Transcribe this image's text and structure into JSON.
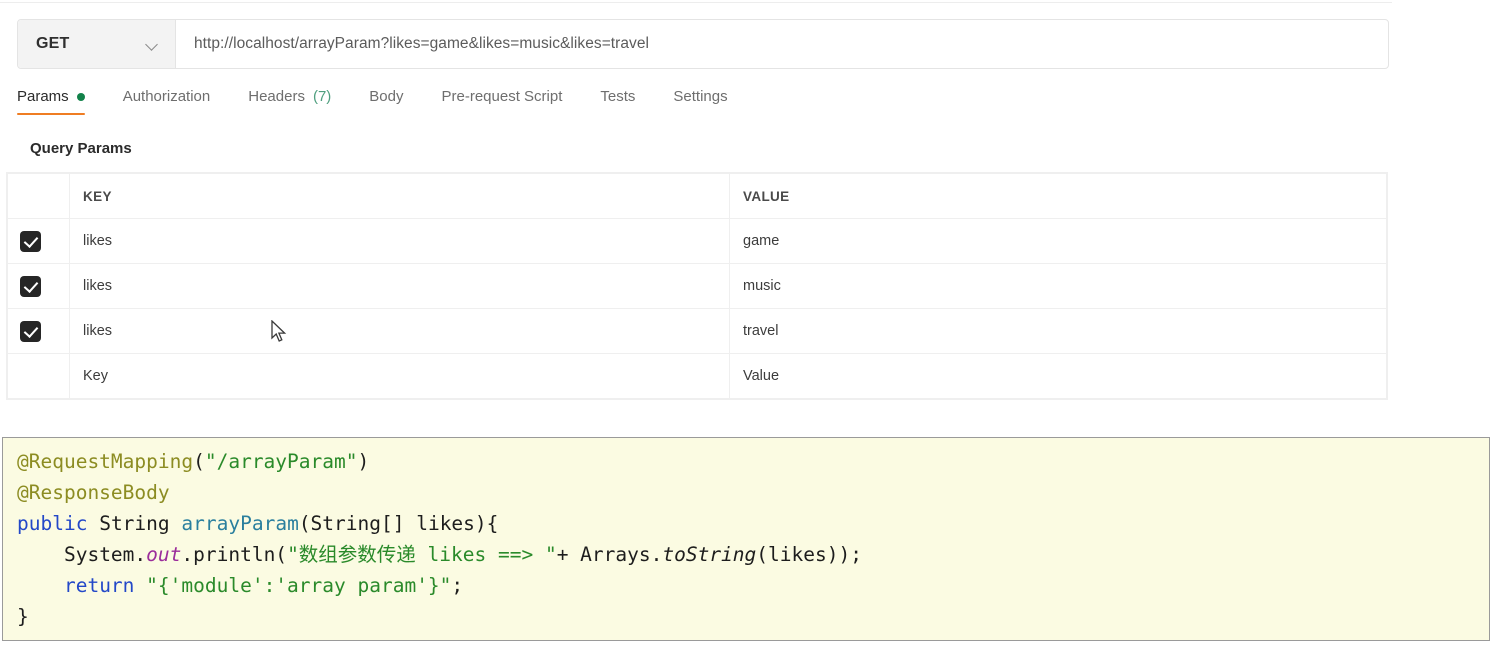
{
  "request": {
    "method": "GET",
    "url": "http://localhost/arrayParam?likes=game&likes=music&likes=travel"
  },
  "tabs": [
    {
      "label": "Params",
      "badge_dot": true,
      "count": "",
      "active": true
    },
    {
      "label": "Authorization",
      "badge_dot": false,
      "count": "",
      "active": false
    },
    {
      "label": "Headers",
      "badge_dot": false,
      "count": "(7)",
      "active": false
    },
    {
      "label": "Body",
      "badge_dot": false,
      "count": "",
      "active": false
    },
    {
      "label": "Pre-request Script",
      "badge_dot": false,
      "count": "",
      "active": false
    },
    {
      "label": "Tests",
      "badge_dot": false,
      "count": "",
      "active": false
    },
    {
      "label": "Settings",
      "badge_dot": false,
      "count": "",
      "active": false
    }
  ],
  "params": {
    "section_title": "Query Params",
    "columns": {
      "key": "KEY",
      "value": "VALUE"
    },
    "rows": [
      {
        "checked": true,
        "key": "likes",
        "value": "game"
      },
      {
        "checked": true,
        "key": "likes",
        "value": "music"
      },
      {
        "checked": true,
        "key": "likes",
        "value": "travel"
      }
    ],
    "placeholder_row": {
      "key": "Key",
      "value": "Value"
    }
  },
  "code": {
    "language": "java",
    "lines": [
      "@RequestMapping(\"/arrayParam\")",
      "@ResponseBody",
      "public String arrayParam(String[] likes){",
      "    System.out.println(\"数组参数传递 likes ==> \"+ Arrays.toString(likes));",
      "    return \"{'module':'array param'}\";",
      "}"
    ],
    "tokens": {
      "ann_request_mapping": "@RequestMapping",
      "paren_open": "(",
      "str_path": "\"/arrayParam\"",
      "paren_close": ")",
      "ann_response_body": "@ResponseBody",
      "kw_public": "public",
      "type_string": "String",
      "meth_array_param": "arrayParam",
      "sig_rest": "(String[] likes){",
      "sys": "System.",
      "field_out": "out",
      "println_open": ".println(",
      "str_cn": "\"数组参数传递 likes ==> \"",
      "plus": "+ ",
      "arrays": "Arrays.",
      "to_string": "toString",
      "args_tail": "(likes));",
      "kw_return": "return",
      "str_module": "\"{'module':'array param'}\"",
      "semi": ";",
      "brace_close": "}"
    }
  },
  "colors": {
    "accent_orange": "#ef7d23",
    "dot_green": "#12824a",
    "count_teal": "#4f9f7f",
    "code_bg": "#fbfbe2",
    "checkbox": "#262626"
  }
}
